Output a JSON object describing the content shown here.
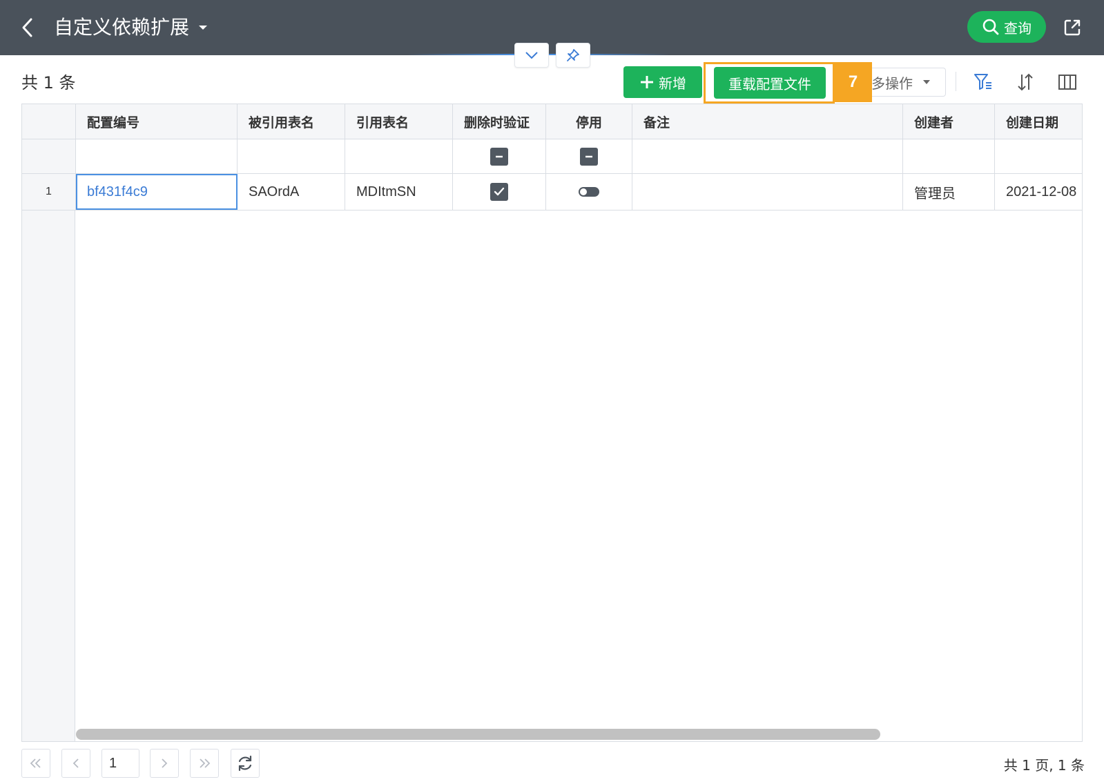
{
  "header": {
    "title": "自定义依赖扩展",
    "query_label": "查询"
  },
  "toolbar": {
    "count_text": "共 1 条",
    "add_label": "新增",
    "reload_label": "重载配置文件",
    "badge_number": "7",
    "more_ops_label": "多操作",
    "highlight_color": "#f5a623",
    "primary_color": "#1db35b"
  },
  "grid": {
    "columns": [
      "配置编号",
      "被引用表名",
      "引用表名",
      "删除时验证",
      "停用",
      "备注",
      "创建者",
      "创建日期"
    ],
    "rows": [
      {
        "row_number": "1",
        "config_id": "bf431f4c9",
        "referenced_table": "SAOrdA",
        "referencing_table": "MDItmSN",
        "validate_on_delete": true,
        "disabled": false,
        "remark": "",
        "creator": "管理员",
        "created_date": "2021-12-08"
      }
    ]
  },
  "pager": {
    "page_value": "1",
    "summary": "共 1 页, 1 条"
  },
  "icons": {
    "back": "chevron-left-icon",
    "title_dropdown": "caret-down-icon",
    "query": "search-icon",
    "export": "external-link-icon",
    "collapse": "chevron-down-icon",
    "pin": "pin-icon",
    "filter": "filter-icon",
    "sort": "sort-icon",
    "columns": "columns-icon",
    "refresh": "refresh-icon"
  }
}
